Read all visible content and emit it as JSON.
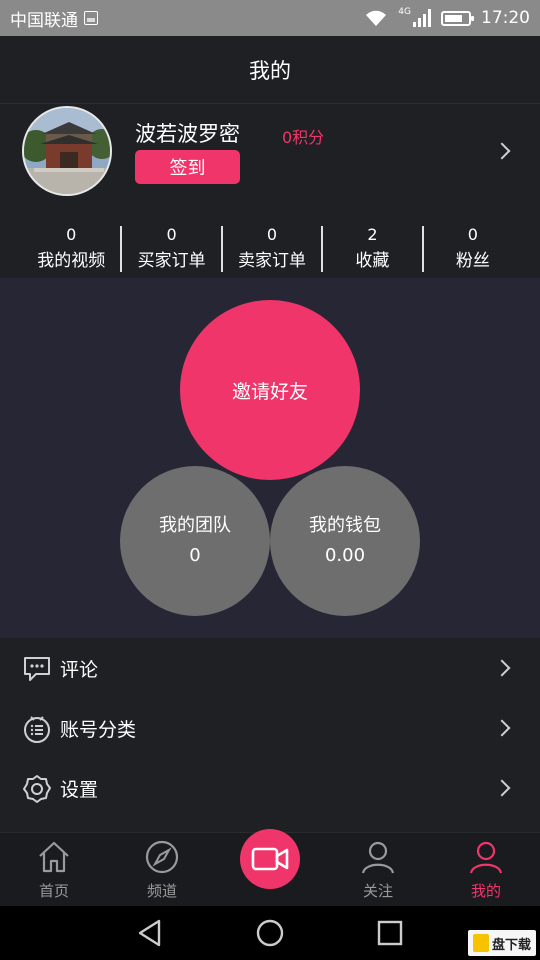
{
  "status_bar": {
    "carrier": "中国联通",
    "network": "4G",
    "time": "17:20",
    "battery_level": 0.75
  },
  "header": {
    "title": "我的"
  },
  "profile": {
    "username": "波若波罗密",
    "points": "0积分",
    "signin_label": "签到"
  },
  "stats": [
    {
      "value": "0",
      "label": "我的视频"
    },
    {
      "value": "0",
      "label": "买家订单"
    },
    {
      "value": "0",
      "label": "卖家订单"
    },
    {
      "value": "2",
      "label": "收藏"
    },
    {
      "value": "0",
      "label": "粉丝"
    }
  ],
  "circles": {
    "invite_label": "邀请好友",
    "team_label": "我的团队",
    "team_value": "0",
    "wallet_label": "我的钱包",
    "wallet_value": "0.00"
  },
  "menu": [
    {
      "label": "评论",
      "icon": "comment-icon"
    },
    {
      "label": "账号分类",
      "icon": "list-icon"
    },
    {
      "label": "设置",
      "icon": "gear-icon"
    }
  ],
  "tabbar": [
    {
      "label": "首页",
      "icon": "home-icon"
    },
    {
      "label": "频道",
      "icon": "compass-icon"
    },
    {
      "label": "",
      "icon": "video-camera-icon"
    },
    {
      "label": "关注",
      "icon": "person-icon"
    },
    {
      "label": "我的",
      "icon": "person-icon"
    }
  ],
  "watermark": {
    "text": "盘下载"
  },
  "colors": {
    "accent": "#f0356b",
    "background": "#1f2023",
    "panel": "#272634",
    "circle_gray": "#6e6e6e"
  }
}
